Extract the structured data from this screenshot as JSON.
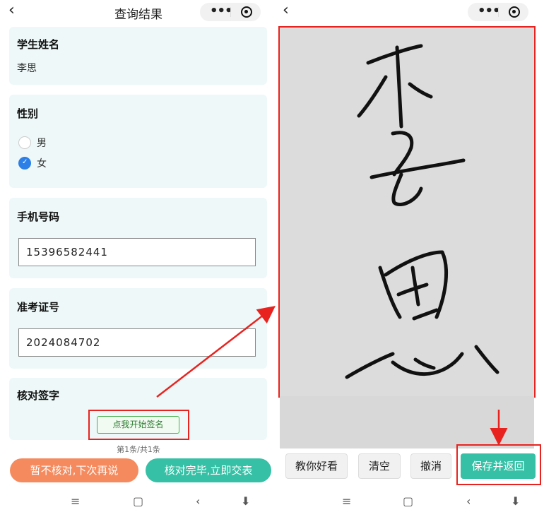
{
  "left_screen": {
    "header": {
      "back_icon": "chevron-left-icon",
      "title": "查询结果",
      "capsule_more": "•••",
      "capsule_icon": "target-icon"
    },
    "student_name": {
      "label": "学生姓名",
      "value": "李思"
    },
    "gender": {
      "label": "性别",
      "options": [
        {
          "label": "男",
          "checked": false
        },
        {
          "label": "女",
          "checked": true
        }
      ]
    },
    "phone": {
      "label": "手机号码",
      "value": "15396582441"
    },
    "exam_id": {
      "label": "准考证号",
      "value": "2024084702"
    },
    "signature": {
      "label": "核对签字",
      "start_button": "点我开始签名"
    },
    "pager": "第1条/共1条",
    "actions": {
      "later": "暂不核对,下次再说",
      "submit": "核对完毕,立即交表"
    },
    "nav_icons": [
      "menu-icon",
      "home-square-icon",
      "back-icon",
      "down-arrow-icon"
    ]
  },
  "right_screen": {
    "header": {
      "back_icon": "chevron-left-icon",
      "capsule_more": "•••",
      "capsule_icon": "target-icon"
    },
    "signature_canvas": {
      "content": "李思"
    },
    "toolbar": {
      "teach": "教你好看",
      "clear": "清空",
      "undo": "撤消",
      "save": "保存并返回"
    },
    "nav_icons": [
      "menu-icon",
      "home-square-icon",
      "back-icon",
      "down-arrow-icon"
    ]
  },
  "colors": {
    "annotation_red": "#e8231f",
    "teal": "#36c0a5",
    "orange": "#f58a5e",
    "checked_blue": "#2b7fe6",
    "card_bg": "#eef8f8"
  }
}
